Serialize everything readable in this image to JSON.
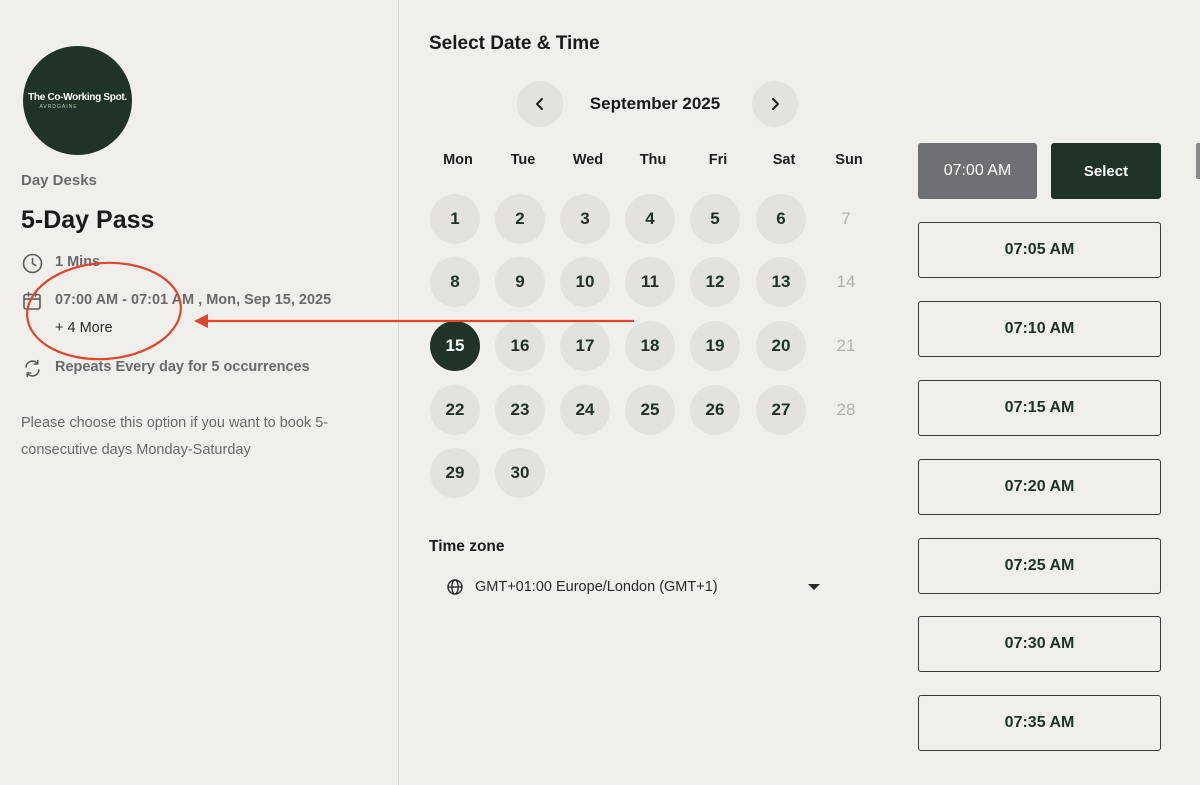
{
  "event": {
    "logo_text": "The Co-Working Spot.",
    "logo_subtext": "AVRDGAINE",
    "category": "Day Desks",
    "title": "5-Day Pass",
    "duration": "1 Mins",
    "datetime": "07:00 AM - 07:01 AM , Mon, Sep 15, 2025",
    "more_link": "+ 4 More",
    "repeat": "Repeats Every day for 5 occurrences",
    "description": "Please choose this option if you want to book 5-consecutive days Monday-Saturday"
  },
  "calendar": {
    "section_title": "Select Date & Time",
    "month": "September 2025",
    "weekdays": [
      "Mon",
      "Tue",
      "Wed",
      "Thu",
      "Fri",
      "Sat",
      "Sun"
    ],
    "weeks": [
      [
        "1",
        "2",
        "3",
        "4",
        "5",
        "6",
        "7"
      ],
      [
        "8",
        "9",
        "10",
        "11",
        "12",
        "13",
        "14"
      ],
      [
        "15",
        "16",
        "17",
        "18",
        "19",
        "20",
        "21"
      ],
      [
        "22",
        "23",
        "24",
        "25",
        "26",
        "27",
        "28"
      ],
      [
        "29",
        "30"
      ]
    ],
    "selected_day": "15",
    "disabled_days": [
      "7",
      "14",
      "21",
      "28"
    ]
  },
  "timezone": {
    "label": "Time zone",
    "value": "GMT+01:00 Europe/London (GMT+1)"
  },
  "slots": {
    "selected_time": "07:00 AM",
    "select_label": "Select",
    "times": [
      "07:05 AM",
      "07:10 AM",
      "07:15 AM",
      "07:20 AM",
      "07:25 AM",
      "07:30 AM",
      "07:35 AM"
    ]
  },
  "colors": {
    "background": "#f1efeb",
    "accent_dark_green": "#1f3427",
    "available_day": "#e4e2dd",
    "selected_slot_gray": "#6f7073",
    "annotation_red": "#e0462b"
  }
}
